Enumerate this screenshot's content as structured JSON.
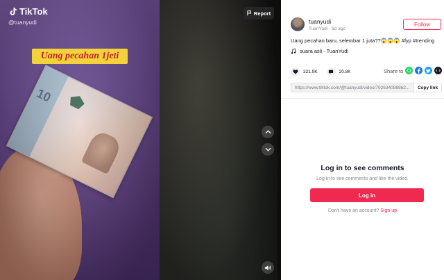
{
  "video": {
    "brand": "TikTok",
    "handle": "@tuanyudi",
    "overlay_caption": "Uang pecahan 1jeti",
    "report_label": "Report"
  },
  "author": {
    "username": "tuanyudi",
    "display_name": "TuanYudi",
    "posted": "6d ago",
    "follow_label": "Follow"
  },
  "post": {
    "description": "Uang pecahan baru, selembar 1 juta??😱😱😱 #fyp #trending",
    "music": "suara asli - TuanYudi"
  },
  "stats": {
    "likes": "321.9K",
    "comments": "20.8K",
    "share_label": "Share to"
  },
  "share_targets": [
    "whatsapp-icon",
    "facebook-icon",
    "twitter-icon",
    "embed-icon"
  ],
  "link": {
    "url": "https://www.tiktok.com/@tuanyudi/video/702634088862...",
    "copy_label": "Copy link"
  },
  "comments": {
    "title": "Log in to see comments",
    "subtitle": "Log in to see comments and like the video.",
    "login_label": "Log in",
    "signup_prompt": "Don't have an account?",
    "signup_label": "Sign up"
  },
  "colors": {
    "accent": "#fe2c55",
    "login_button": "#ef2950"
  }
}
